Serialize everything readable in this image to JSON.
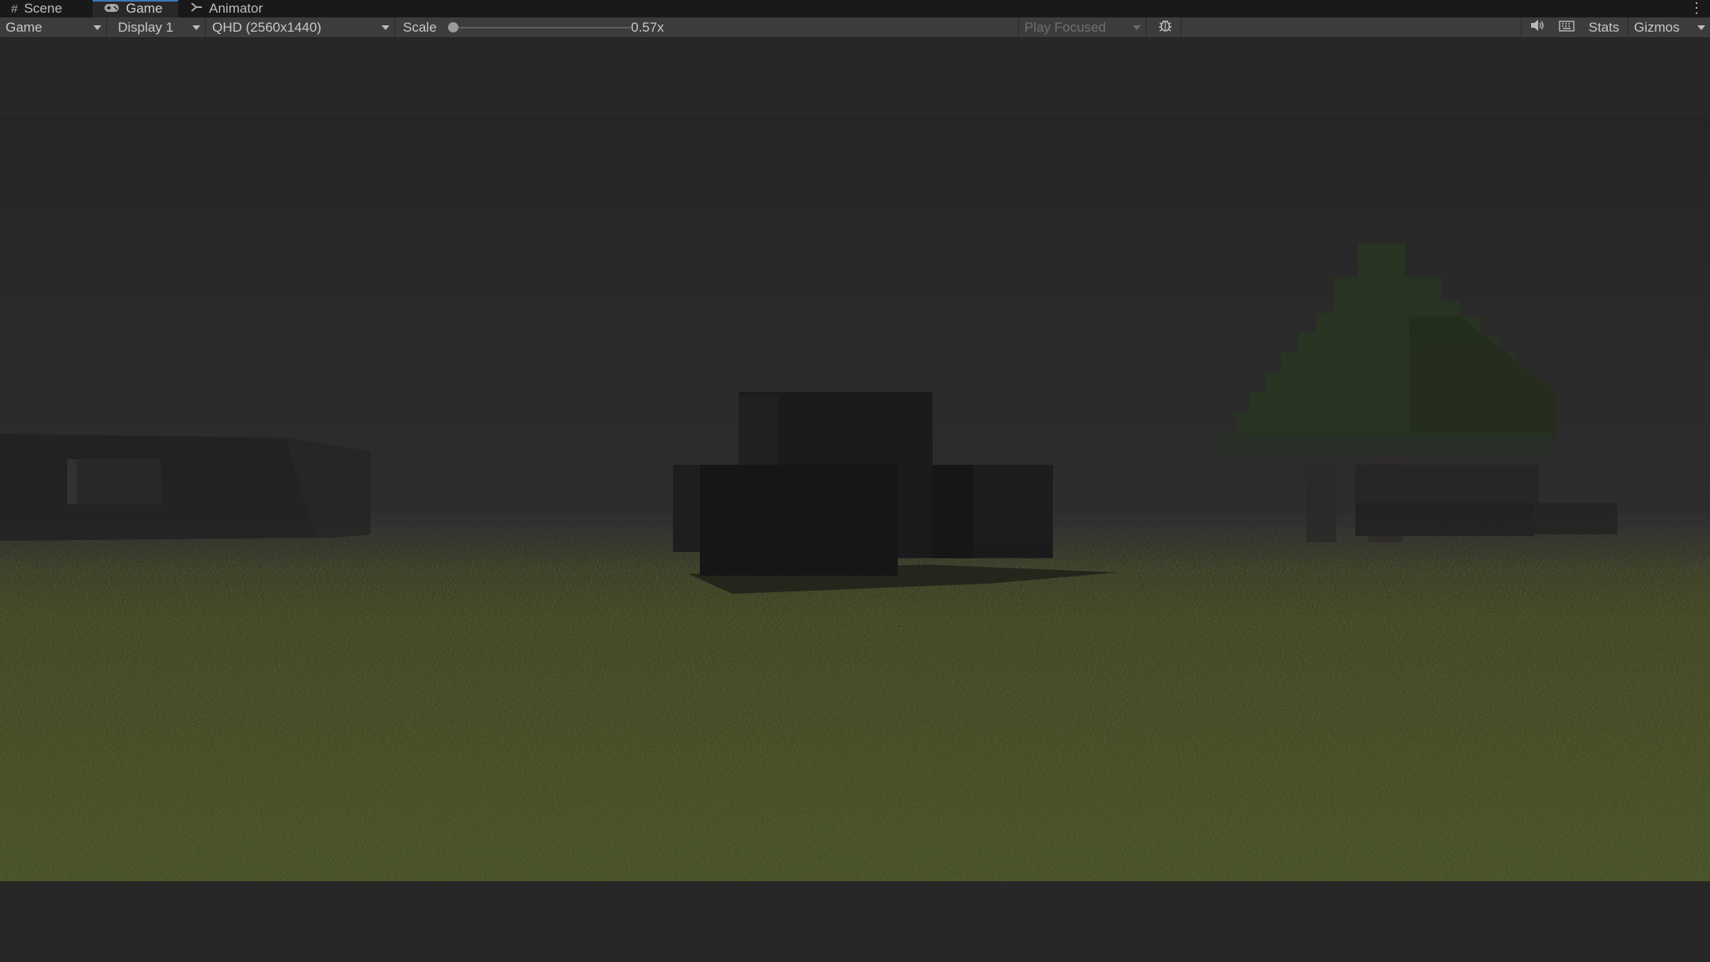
{
  "tabs": [
    {
      "label": "Scene",
      "icon": "grid-icon"
    },
    {
      "label": "Game",
      "icon": "gamepad-icon",
      "active": true
    },
    {
      "label": "Animator",
      "icon": "animator-icon"
    }
  ],
  "toolbar": {
    "view_mode": "Game",
    "display": "Display 1",
    "resolution": "QHD (2560x1440)",
    "scale_label": "Scale",
    "scale_value": "0.57x",
    "scale_level": 0.57,
    "play_mode": "Play Focused",
    "stats_label": "Stats",
    "gizmos_label": "Gizmos"
  },
  "colors": {
    "tab_accent": "#3a79bb",
    "sky": "#2f2f2f",
    "grass": "#4f5a28",
    "tree_leaves": "#2c3a22"
  }
}
